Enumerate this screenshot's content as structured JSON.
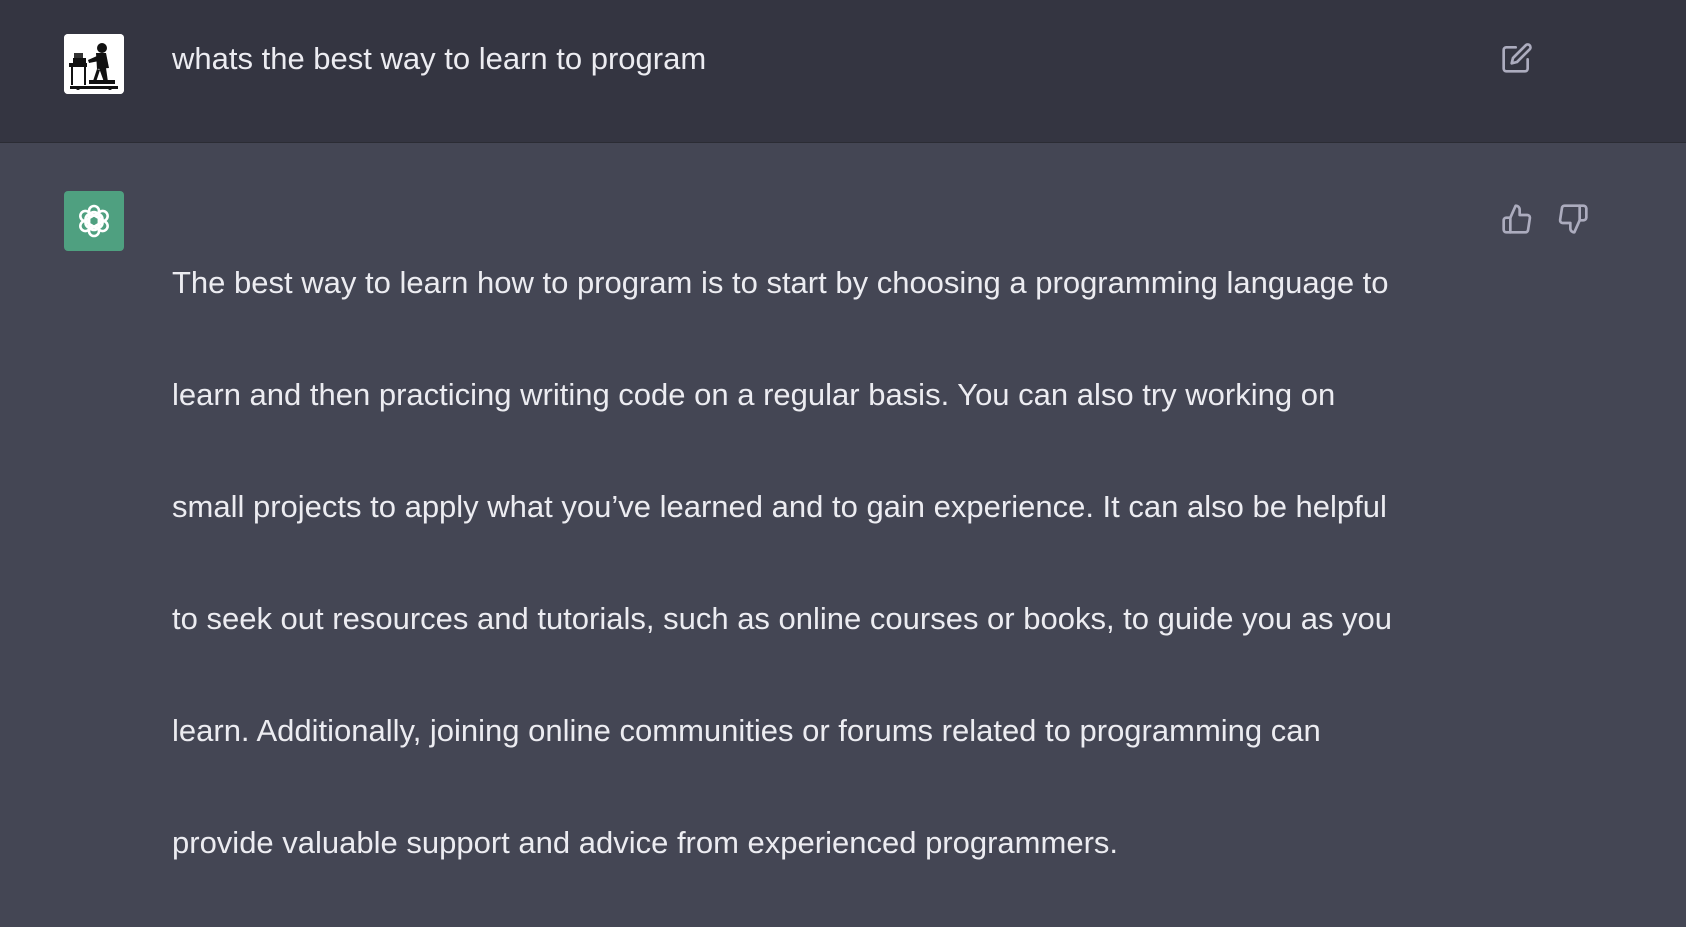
{
  "conversation": {
    "user_message": {
      "text": "whats the best way to learn to program",
      "avatar_icon": "user-avatar-person-at-computer",
      "actions": {
        "edit_icon": "edit-icon"
      }
    },
    "assistant_message": {
      "lines": [
        "The best way to learn how to program is to start by choosing a programming language to",
        "learn and then practicing writing code on a regular basis. You can also try working on",
        "small projects to apply what you’ve learned and to gain experience. It can also be helpful",
        "to seek out resources and tutorials, such as online courses or books, to guide you as you",
        "learn. Additionally, joining online communities or forums related to programming can",
        "provide valuable support and advice from experienced programmers."
      ],
      "avatar_icon": "assistant-logo-icon",
      "actions": {
        "thumbs_up_icon": "thumbs-up-icon",
        "thumbs_down_icon": "thumbs-down-icon"
      }
    }
  },
  "colors": {
    "user_background": "#343541",
    "assistant_background": "#444654",
    "text": "#ececf1",
    "icon": "#acacbe",
    "assistant_avatar": "#4fa080"
  }
}
